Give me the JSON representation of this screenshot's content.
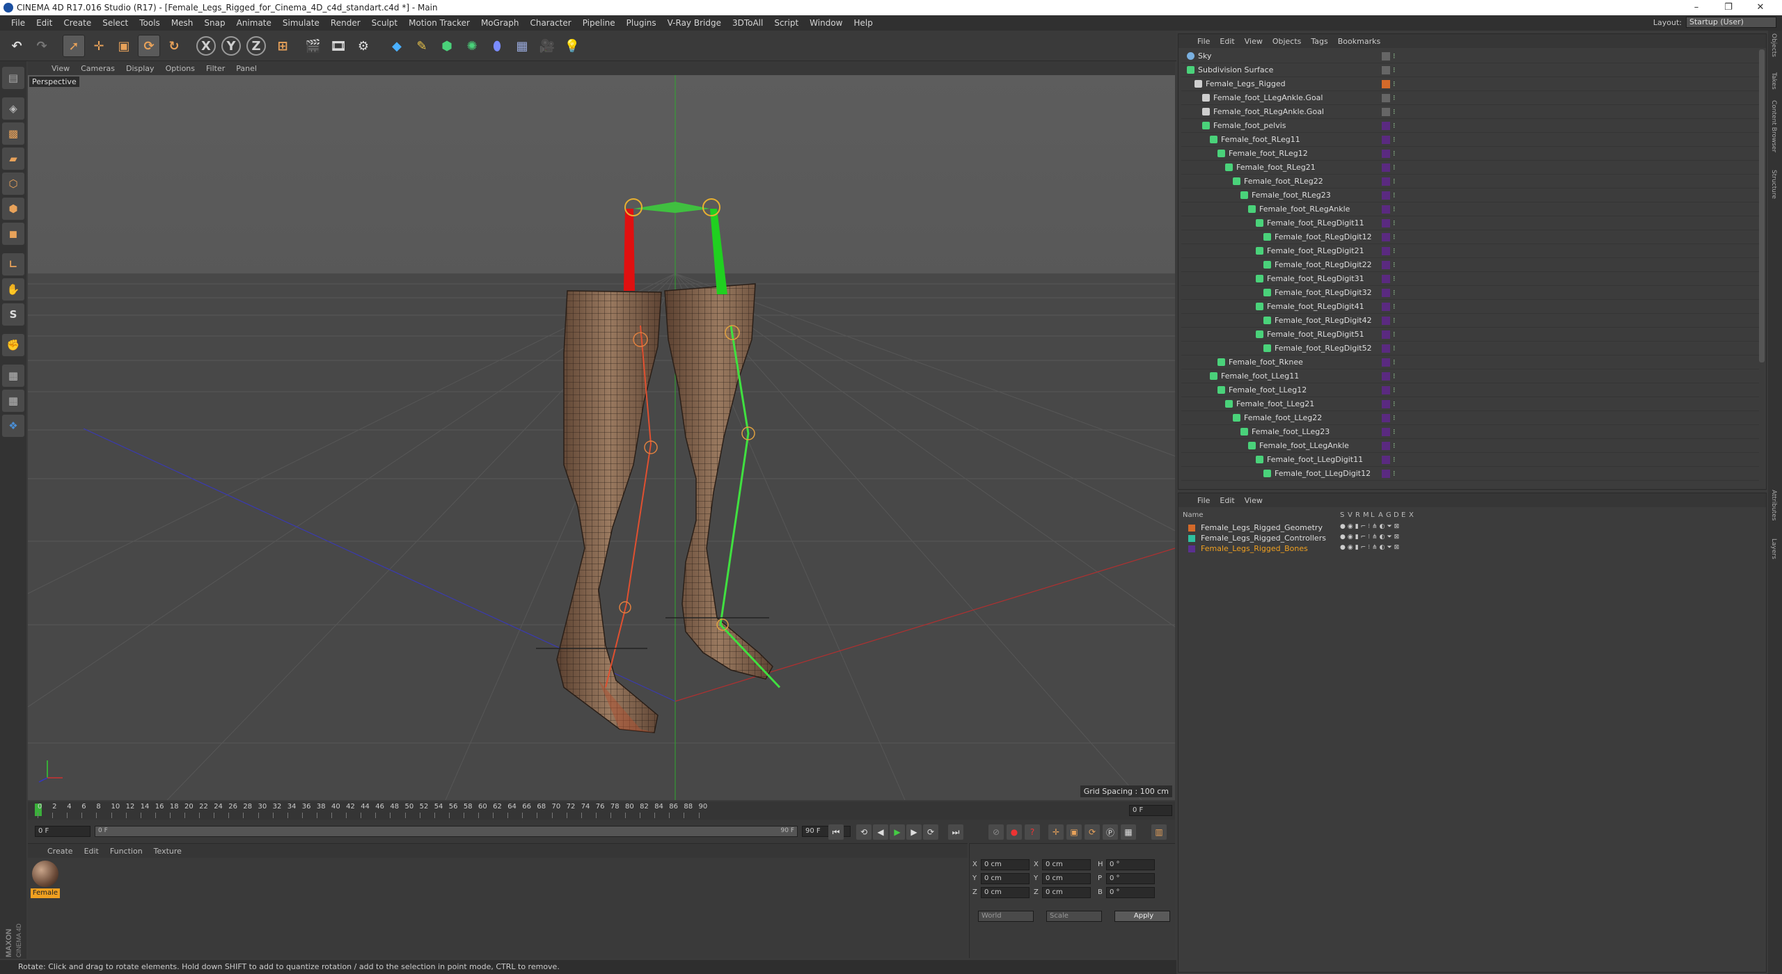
{
  "titlebar": {
    "title": "CINEMA 4D R17.016 Studio (R17) - [Female_Legs_Rigged_for_Cinema_4D_c4d_standart.c4d *] - Main",
    "minimize": "–",
    "restore": "❐",
    "close": "✕"
  },
  "menubar": {
    "items": [
      "File",
      "Edit",
      "Create",
      "Select",
      "Tools",
      "Mesh",
      "Snap",
      "Animate",
      "Simulate",
      "Render",
      "Sculpt",
      "Motion Tracker",
      "MoGraph",
      "Character",
      "Pipeline",
      "Plugins",
      "V-Ray Bridge",
      "3DToAll",
      "Script",
      "Window",
      "Help"
    ],
    "layout_label": "Layout:",
    "layout_value": "Startup (User)"
  },
  "toolbar": {
    "x": "X",
    "y": "Y",
    "z": "Z"
  },
  "viewport": {
    "menu": [
      "View",
      "Cameras",
      "Display",
      "Options",
      "Filter",
      "Panel"
    ],
    "label": "Perspective",
    "grid_spacing": "Grid Spacing : 100 cm"
  },
  "timeline": {
    "ticks": [
      "0",
      "2",
      "4",
      "6",
      "8",
      "10",
      "12",
      "14",
      "16",
      "18",
      "20",
      "22",
      "24",
      "26",
      "28",
      "30",
      "32",
      "34",
      "36",
      "38",
      "40",
      "42",
      "44",
      "46",
      "48",
      "50",
      "52",
      "54",
      "56",
      "58",
      "60",
      "62",
      "64",
      "66",
      "68",
      "70",
      "72",
      "74",
      "76",
      "78",
      "80",
      "82",
      "84",
      "86",
      "88",
      "90"
    ],
    "current_frame": "0 F"
  },
  "transport": {
    "start": "0 F",
    "range_start": "0 F",
    "range_end": "90 F",
    "end": "90 F"
  },
  "materials": {
    "menu": [
      "Create",
      "Edit",
      "Function",
      "Texture"
    ],
    "items": [
      {
        "name": "Female"
      }
    ]
  },
  "coords": {
    "rows": [
      {
        "a": "X",
        "av": "0 cm",
        "b": "X",
        "bv": "0 cm",
        "c": "H",
        "cv": "0 °"
      },
      {
        "a": "Y",
        "av": "0 cm",
        "b": "Y",
        "bv": "0 cm",
        "c": "P",
        "cv": "0 °"
      },
      {
        "a": "Z",
        "av": "0 cm",
        "b": "Z",
        "bv": "0 cm",
        "c": "B",
        "cv": "0 °"
      }
    ],
    "world": "World",
    "scale": "Scale",
    "apply": "Apply"
  },
  "status": "Rotate: Click and drag to rotate elements. Hold down SHIFT to add to quantize rotation / add to the selection in point mode, CTRL to remove.",
  "objects": {
    "menu": [
      "File",
      "Edit",
      "View",
      "Objects",
      "Tags",
      "Bookmarks"
    ],
    "rows": [
      {
        "name": "Sky",
        "depth": 0,
        "type": "sky"
      },
      {
        "name": "Subdivision Surface",
        "depth": 0,
        "type": "subd"
      },
      {
        "name": "Female_Legs_Rigged",
        "depth": 1,
        "type": "null"
      },
      {
        "name": "Female_foot_LLegAnkle.Goal",
        "depth": 2,
        "type": "null"
      },
      {
        "name": "Female_foot_RLegAnkle.Goal",
        "depth": 2,
        "type": "null"
      },
      {
        "name": "Female_foot_pelvis",
        "depth": 2,
        "type": "bone"
      },
      {
        "name": "Female_foot_RLeg11",
        "depth": 3,
        "type": "bone"
      },
      {
        "name": "Female_foot_RLeg12",
        "depth": 4,
        "type": "bone"
      },
      {
        "name": "Female_foot_RLeg21",
        "depth": 5,
        "type": "bone"
      },
      {
        "name": "Female_foot_RLeg22",
        "depth": 6,
        "type": "bone"
      },
      {
        "name": "Female_foot_RLeg23",
        "depth": 7,
        "type": "bone"
      },
      {
        "name": "Female_foot_RLegAnkle",
        "depth": 8,
        "type": "bone"
      },
      {
        "name": "Female_foot_RLegDigit11",
        "depth": 9,
        "type": "bone"
      },
      {
        "name": "Female_foot_RLegDigit12",
        "depth": 10,
        "type": "bone"
      },
      {
        "name": "Female_foot_RLegDigit21",
        "depth": 9,
        "type": "bone"
      },
      {
        "name": "Female_foot_RLegDigit22",
        "depth": 10,
        "type": "bone"
      },
      {
        "name": "Female_foot_RLegDigit31",
        "depth": 9,
        "type": "bone"
      },
      {
        "name": "Female_foot_RLegDigit32",
        "depth": 10,
        "type": "bone"
      },
      {
        "name": "Female_foot_RLegDigit41",
        "depth": 9,
        "type": "bone"
      },
      {
        "name": "Female_foot_RLegDigit42",
        "depth": 10,
        "type": "bone"
      },
      {
        "name": "Female_foot_RLegDigit51",
        "depth": 9,
        "type": "bone"
      },
      {
        "name": "Female_foot_RLegDigit52",
        "depth": 10,
        "type": "bone"
      },
      {
        "name": "Female_foot_Rknee",
        "depth": 4,
        "type": "bone"
      },
      {
        "name": "Female_foot_LLeg11",
        "depth": 3,
        "type": "bone"
      },
      {
        "name": "Female_foot_LLeg12",
        "depth": 4,
        "type": "bone"
      },
      {
        "name": "Female_foot_LLeg21",
        "depth": 5,
        "type": "bone"
      },
      {
        "name": "Female_foot_LLeg22",
        "depth": 6,
        "type": "bone"
      },
      {
        "name": "Female_foot_LLeg23",
        "depth": 7,
        "type": "bone"
      },
      {
        "name": "Female_foot_LLegAnkle",
        "depth": 8,
        "type": "bone"
      },
      {
        "name": "Female_foot_LLegDigit11",
        "depth": 9,
        "type": "bone"
      },
      {
        "name": "Female_foot_LLegDigit12",
        "depth": 10,
        "type": "bone"
      }
    ]
  },
  "layers": {
    "menu": [
      "File",
      "Edit",
      "View"
    ],
    "headers": [
      "Name",
      "S",
      "V",
      "R",
      "M",
      "L",
      "A",
      "G",
      "D",
      "E",
      "X"
    ],
    "rows": [
      {
        "name": "Female_Legs_Rigged_Geometry",
        "color": "#d46a2a",
        "selected": false
      },
      {
        "name": "Female_Legs_Rigged_Controllers",
        "color": "#2ec0a0",
        "selected": false
      },
      {
        "name": "Female_Legs_Rigged_Bones",
        "color": "#5a3090",
        "selected": true
      }
    ]
  },
  "side_tabs": [
    "Objects",
    "Takes",
    "Content Browser",
    "Structure",
    "Attributes",
    "Layers"
  ]
}
